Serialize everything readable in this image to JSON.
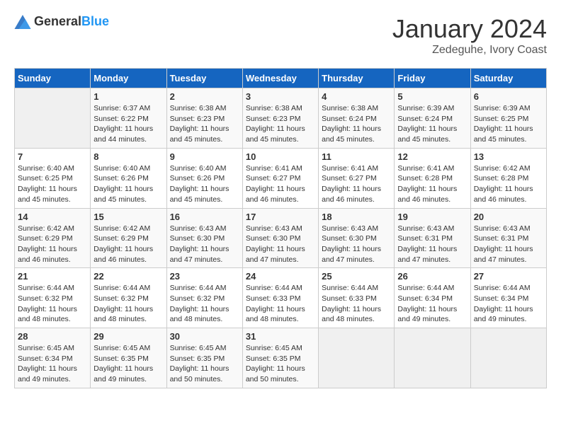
{
  "header": {
    "logo_general": "General",
    "logo_blue": "Blue",
    "month": "January 2024",
    "location": "Zedeguhe, Ivory Coast"
  },
  "days_of_week": [
    "Sunday",
    "Monday",
    "Tuesday",
    "Wednesday",
    "Thursday",
    "Friday",
    "Saturday"
  ],
  "weeks": [
    [
      {
        "day": "",
        "sunrise": "",
        "sunset": "",
        "daylight": ""
      },
      {
        "day": "1",
        "sunrise": "Sunrise: 6:37 AM",
        "sunset": "Sunset: 6:22 PM",
        "daylight": "Daylight: 11 hours and 44 minutes."
      },
      {
        "day": "2",
        "sunrise": "Sunrise: 6:38 AM",
        "sunset": "Sunset: 6:23 PM",
        "daylight": "Daylight: 11 hours and 45 minutes."
      },
      {
        "day": "3",
        "sunrise": "Sunrise: 6:38 AM",
        "sunset": "Sunset: 6:23 PM",
        "daylight": "Daylight: 11 hours and 45 minutes."
      },
      {
        "day": "4",
        "sunrise": "Sunrise: 6:38 AM",
        "sunset": "Sunset: 6:24 PM",
        "daylight": "Daylight: 11 hours and 45 minutes."
      },
      {
        "day": "5",
        "sunrise": "Sunrise: 6:39 AM",
        "sunset": "Sunset: 6:24 PM",
        "daylight": "Daylight: 11 hours and 45 minutes."
      },
      {
        "day": "6",
        "sunrise": "Sunrise: 6:39 AM",
        "sunset": "Sunset: 6:25 PM",
        "daylight": "Daylight: 11 hours and 45 minutes."
      }
    ],
    [
      {
        "day": "7",
        "sunrise": "Sunrise: 6:40 AM",
        "sunset": "Sunset: 6:25 PM",
        "daylight": "Daylight: 11 hours and 45 minutes."
      },
      {
        "day": "8",
        "sunrise": "Sunrise: 6:40 AM",
        "sunset": "Sunset: 6:26 PM",
        "daylight": "Daylight: 11 hours and 45 minutes."
      },
      {
        "day": "9",
        "sunrise": "Sunrise: 6:40 AM",
        "sunset": "Sunset: 6:26 PM",
        "daylight": "Daylight: 11 hours and 45 minutes."
      },
      {
        "day": "10",
        "sunrise": "Sunrise: 6:41 AM",
        "sunset": "Sunset: 6:27 PM",
        "daylight": "Daylight: 11 hours and 46 minutes."
      },
      {
        "day": "11",
        "sunrise": "Sunrise: 6:41 AM",
        "sunset": "Sunset: 6:27 PM",
        "daylight": "Daylight: 11 hours and 46 minutes."
      },
      {
        "day": "12",
        "sunrise": "Sunrise: 6:41 AM",
        "sunset": "Sunset: 6:28 PM",
        "daylight": "Daylight: 11 hours and 46 minutes."
      },
      {
        "day": "13",
        "sunrise": "Sunrise: 6:42 AM",
        "sunset": "Sunset: 6:28 PM",
        "daylight": "Daylight: 11 hours and 46 minutes."
      }
    ],
    [
      {
        "day": "14",
        "sunrise": "Sunrise: 6:42 AM",
        "sunset": "Sunset: 6:29 PM",
        "daylight": "Daylight: 11 hours and 46 minutes."
      },
      {
        "day": "15",
        "sunrise": "Sunrise: 6:42 AM",
        "sunset": "Sunset: 6:29 PM",
        "daylight": "Daylight: 11 hours and 46 minutes."
      },
      {
        "day": "16",
        "sunrise": "Sunrise: 6:43 AM",
        "sunset": "Sunset: 6:30 PM",
        "daylight": "Daylight: 11 hours and 47 minutes."
      },
      {
        "day": "17",
        "sunrise": "Sunrise: 6:43 AM",
        "sunset": "Sunset: 6:30 PM",
        "daylight": "Daylight: 11 hours and 47 minutes."
      },
      {
        "day": "18",
        "sunrise": "Sunrise: 6:43 AM",
        "sunset": "Sunset: 6:30 PM",
        "daylight": "Daylight: 11 hours and 47 minutes."
      },
      {
        "day": "19",
        "sunrise": "Sunrise: 6:43 AM",
        "sunset": "Sunset: 6:31 PM",
        "daylight": "Daylight: 11 hours and 47 minutes."
      },
      {
        "day": "20",
        "sunrise": "Sunrise: 6:43 AM",
        "sunset": "Sunset: 6:31 PM",
        "daylight": "Daylight: 11 hours and 47 minutes."
      }
    ],
    [
      {
        "day": "21",
        "sunrise": "Sunrise: 6:44 AM",
        "sunset": "Sunset: 6:32 PM",
        "daylight": "Daylight: 11 hours and 48 minutes."
      },
      {
        "day": "22",
        "sunrise": "Sunrise: 6:44 AM",
        "sunset": "Sunset: 6:32 PM",
        "daylight": "Daylight: 11 hours and 48 minutes."
      },
      {
        "day": "23",
        "sunrise": "Sunrise: 6:44 AM",
        "sunset": "Sunset: 6:32 PM",
        "daylight": "Daylight: 11 hours and 48 minutes."
      },
      {
        "day": "24",
        "sunrise": "Sunrise: 6:44 AM",
        "sunset": "Sunset: 6:33 PM",
        "daylight": "Daylight: 11 hours and 48 minutes."
      },
      {
        "day": "25",
        "sunrise": "Sunrise: 6:44 AM",
        "sunset": "Sunset: 6:33 PM",
        "daylight": "Daylight: 11 hours and 48 minutes."
      },
      {
        "day": "26",
        "sunrise": "Sunrise: 6:44 AM",
        "sunset": "Sunset: 6:34 PM",
        "daylight": "Daylight: 11 hours and 49 minutes."
      },
      {
        "day": "27",
        "sunrise": "Sunrise: 6:44 AM",
        "sunset": "Sunset: 6:34 PM",
        "daylight": "Daylight: 11 hours and 49 minutes."
      }
    ],
    [
      {
        "day": "28",
        "sunrise": "Sunrise: 6:45 AM",
        "sunset": "Sunset: 6:34 PM",
        "daylight": "Daylight: 11 hours and 49 minutes."
      },
      {
        "day": "29",
        "sunrise": "Sunrise: 6:45 AM",
        "sunset": "Sunset: 6:35 PM",
        "daylight": "Daylight: 11 hours and 49 minutes."
      },
      {
        "day": "30",
        "sunrise": "Sunrise: 6:45 AM",
        "sunset": "Sunset: 6:35 PM",
        "daylight": "Daylight: 11 hours and 50 minutes."
      },
      {
        "day": "31",
        "sunrise": "Sunrise: 6:45 AM",
        "sunset": "Sunset: 6:35 PM",
        "daylight": "Daylight: 11 hours and 50 minutes."
      },
      {
        "day": "",
        "sunrise": "",
        "sunset": "",
        "daylight": ""
      },
      {
        "day": "",
        "sunrise": "",
        "sunset": "",
        "daylight": ""
      },
      {
        "day": "",
        "sunrise": "",
        "sunset": "",
        "daylight": ""
      }
    ]
  ]
}
